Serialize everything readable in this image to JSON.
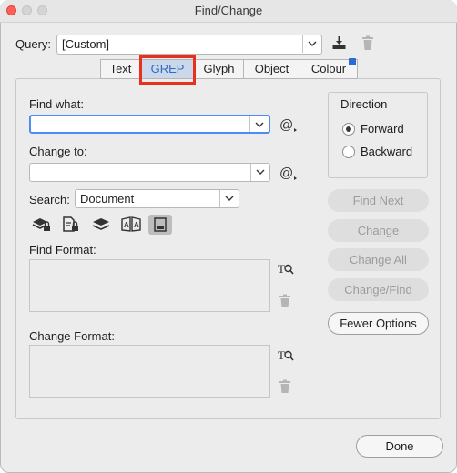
{
  "window": {
    "title": "Find/Change"
  },
  "query": {
    "label": "Query:",
    "value": "[Custom]"
  },
  "tabs": [
    {
      "label": "Text"
    },
    {
      "label": "GREP"
    },
    {
      "label": "Glyph"
    },
    {
      "label": "Object"
    },
    {
      "label": "Colour"
    }
  ],
  "active_tab": "GREP",
  "find_what": {
    "label": "Find what:",
    "value": ""
  },
  "change_to": {
    "label": "Change to:",
    "value": ""
  },
  "search": {
    "label": "Search:",
    "value": "Document"
  },
  "find_format": {
    "label": "Find Format:"
  },
  "change_format": {
    "label": "Change Format:"
  },
  "direction": {
    "label": "Direction",
    "options": [
      "Forward",
      "Backward"
    ],
    "selected": "Forward"
  },
  "buttons": {
    "find_next": "Find Next",
    "change": "Change",
    "change_all": "Change All",
    "change_find": "Change/Find",
    "fewer_options": "Fewer Options",
    "done": "Done"
  },
  "colors": {
    "highlight": "#e8301f",
    "accent": "#2d6bd4",
    "active_tab_text": "#2f6bbf"
  }
}
